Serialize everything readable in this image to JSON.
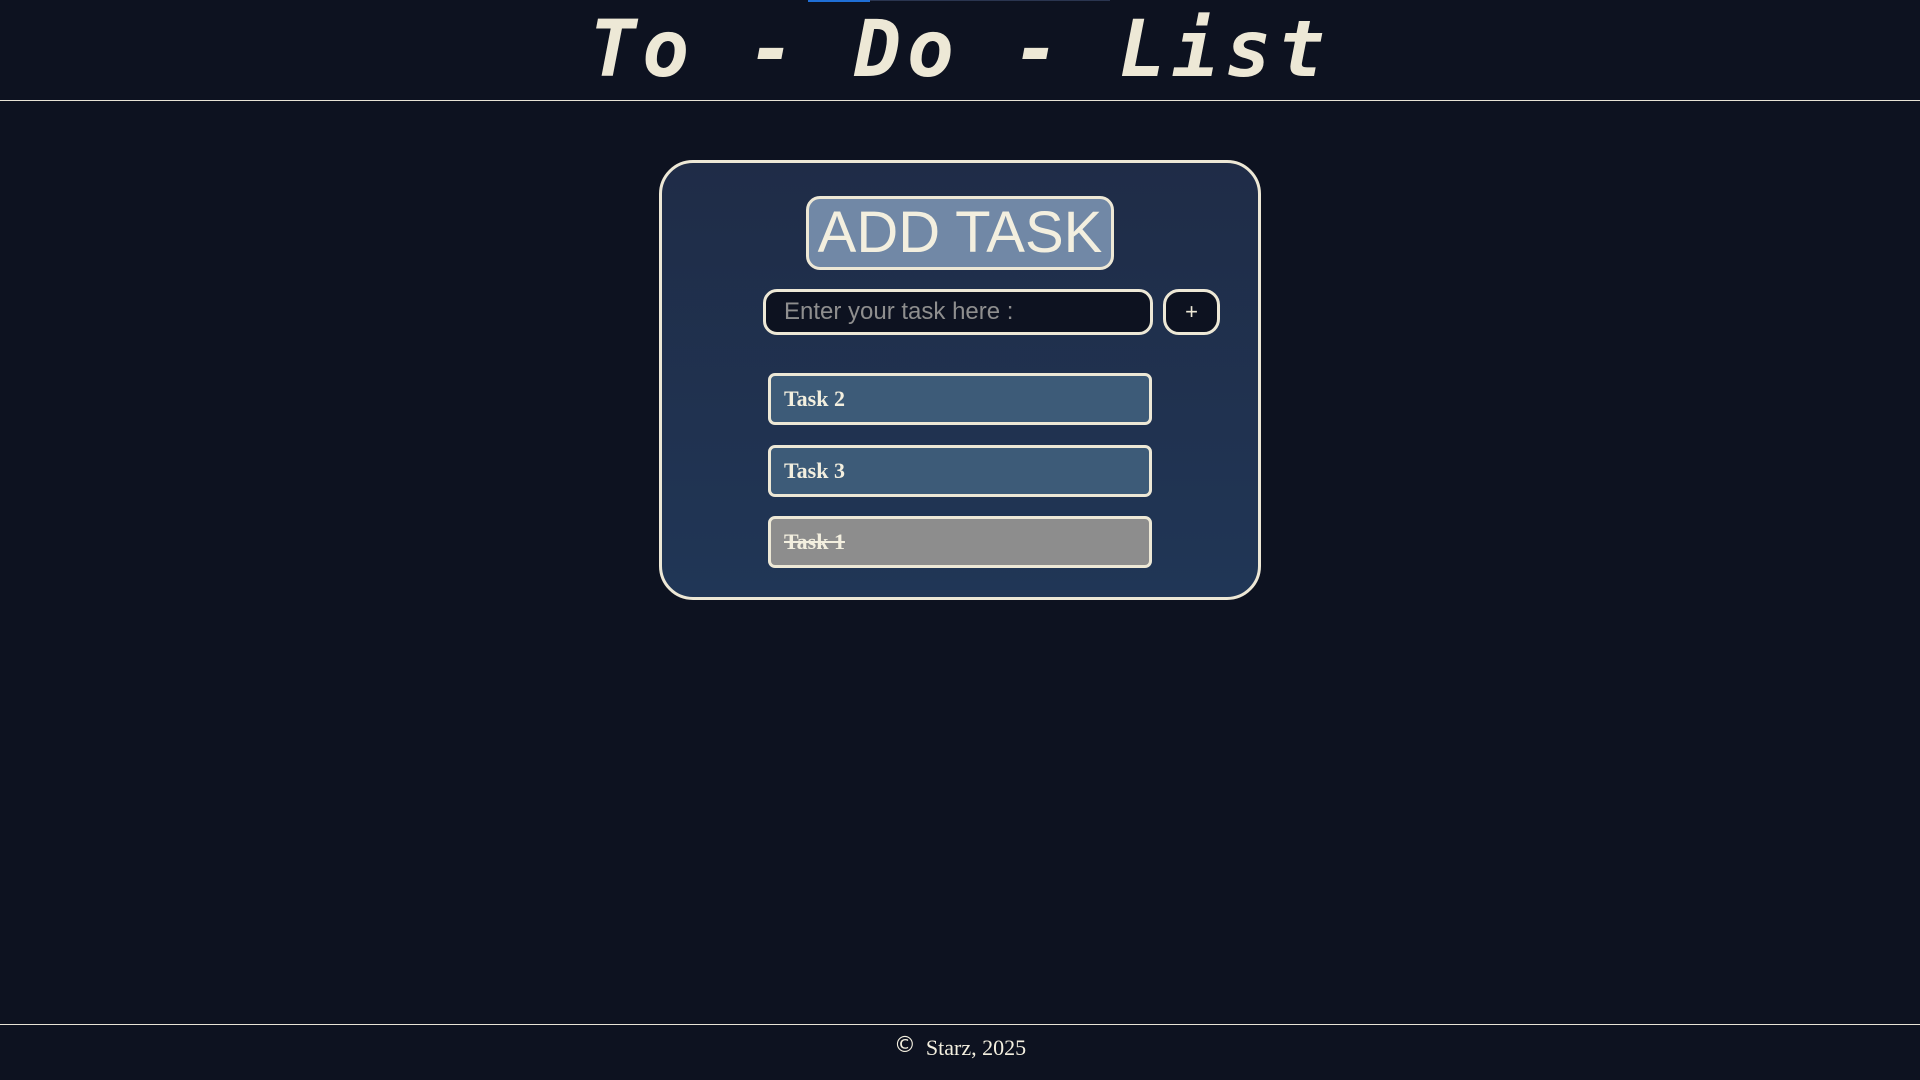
{
  "header": {
    "title": "To - Do - List"
  },
  "card": {
    "add_task_label": "ADD TASK",
    "input_placeholder": "Enter your task here :",
    "input_value": "",
    "plus_label": "+",
    "tasks": [
      {
        "label": "Task 2",
        "completed": false
      },
      {
        "label": "Task 3",
        "completed": false
      },
      {
        "label": "Task 1",
        "completed": true
      }
    ]
  },
  "footer": {
    "copyright_symbol": "©",
    "text": "Starz, 2025"
  },
  "colors": {
    "background": "#0d1220",
    "card_background": "#1f2c47",
    "foreground": "#ede8d6",
    "add_button": "#7188a6",
    "task_active": "#3d5b78",
    "task_done": "#8d8d8d",
    "accent": "#1f6fd6"
  }
}
